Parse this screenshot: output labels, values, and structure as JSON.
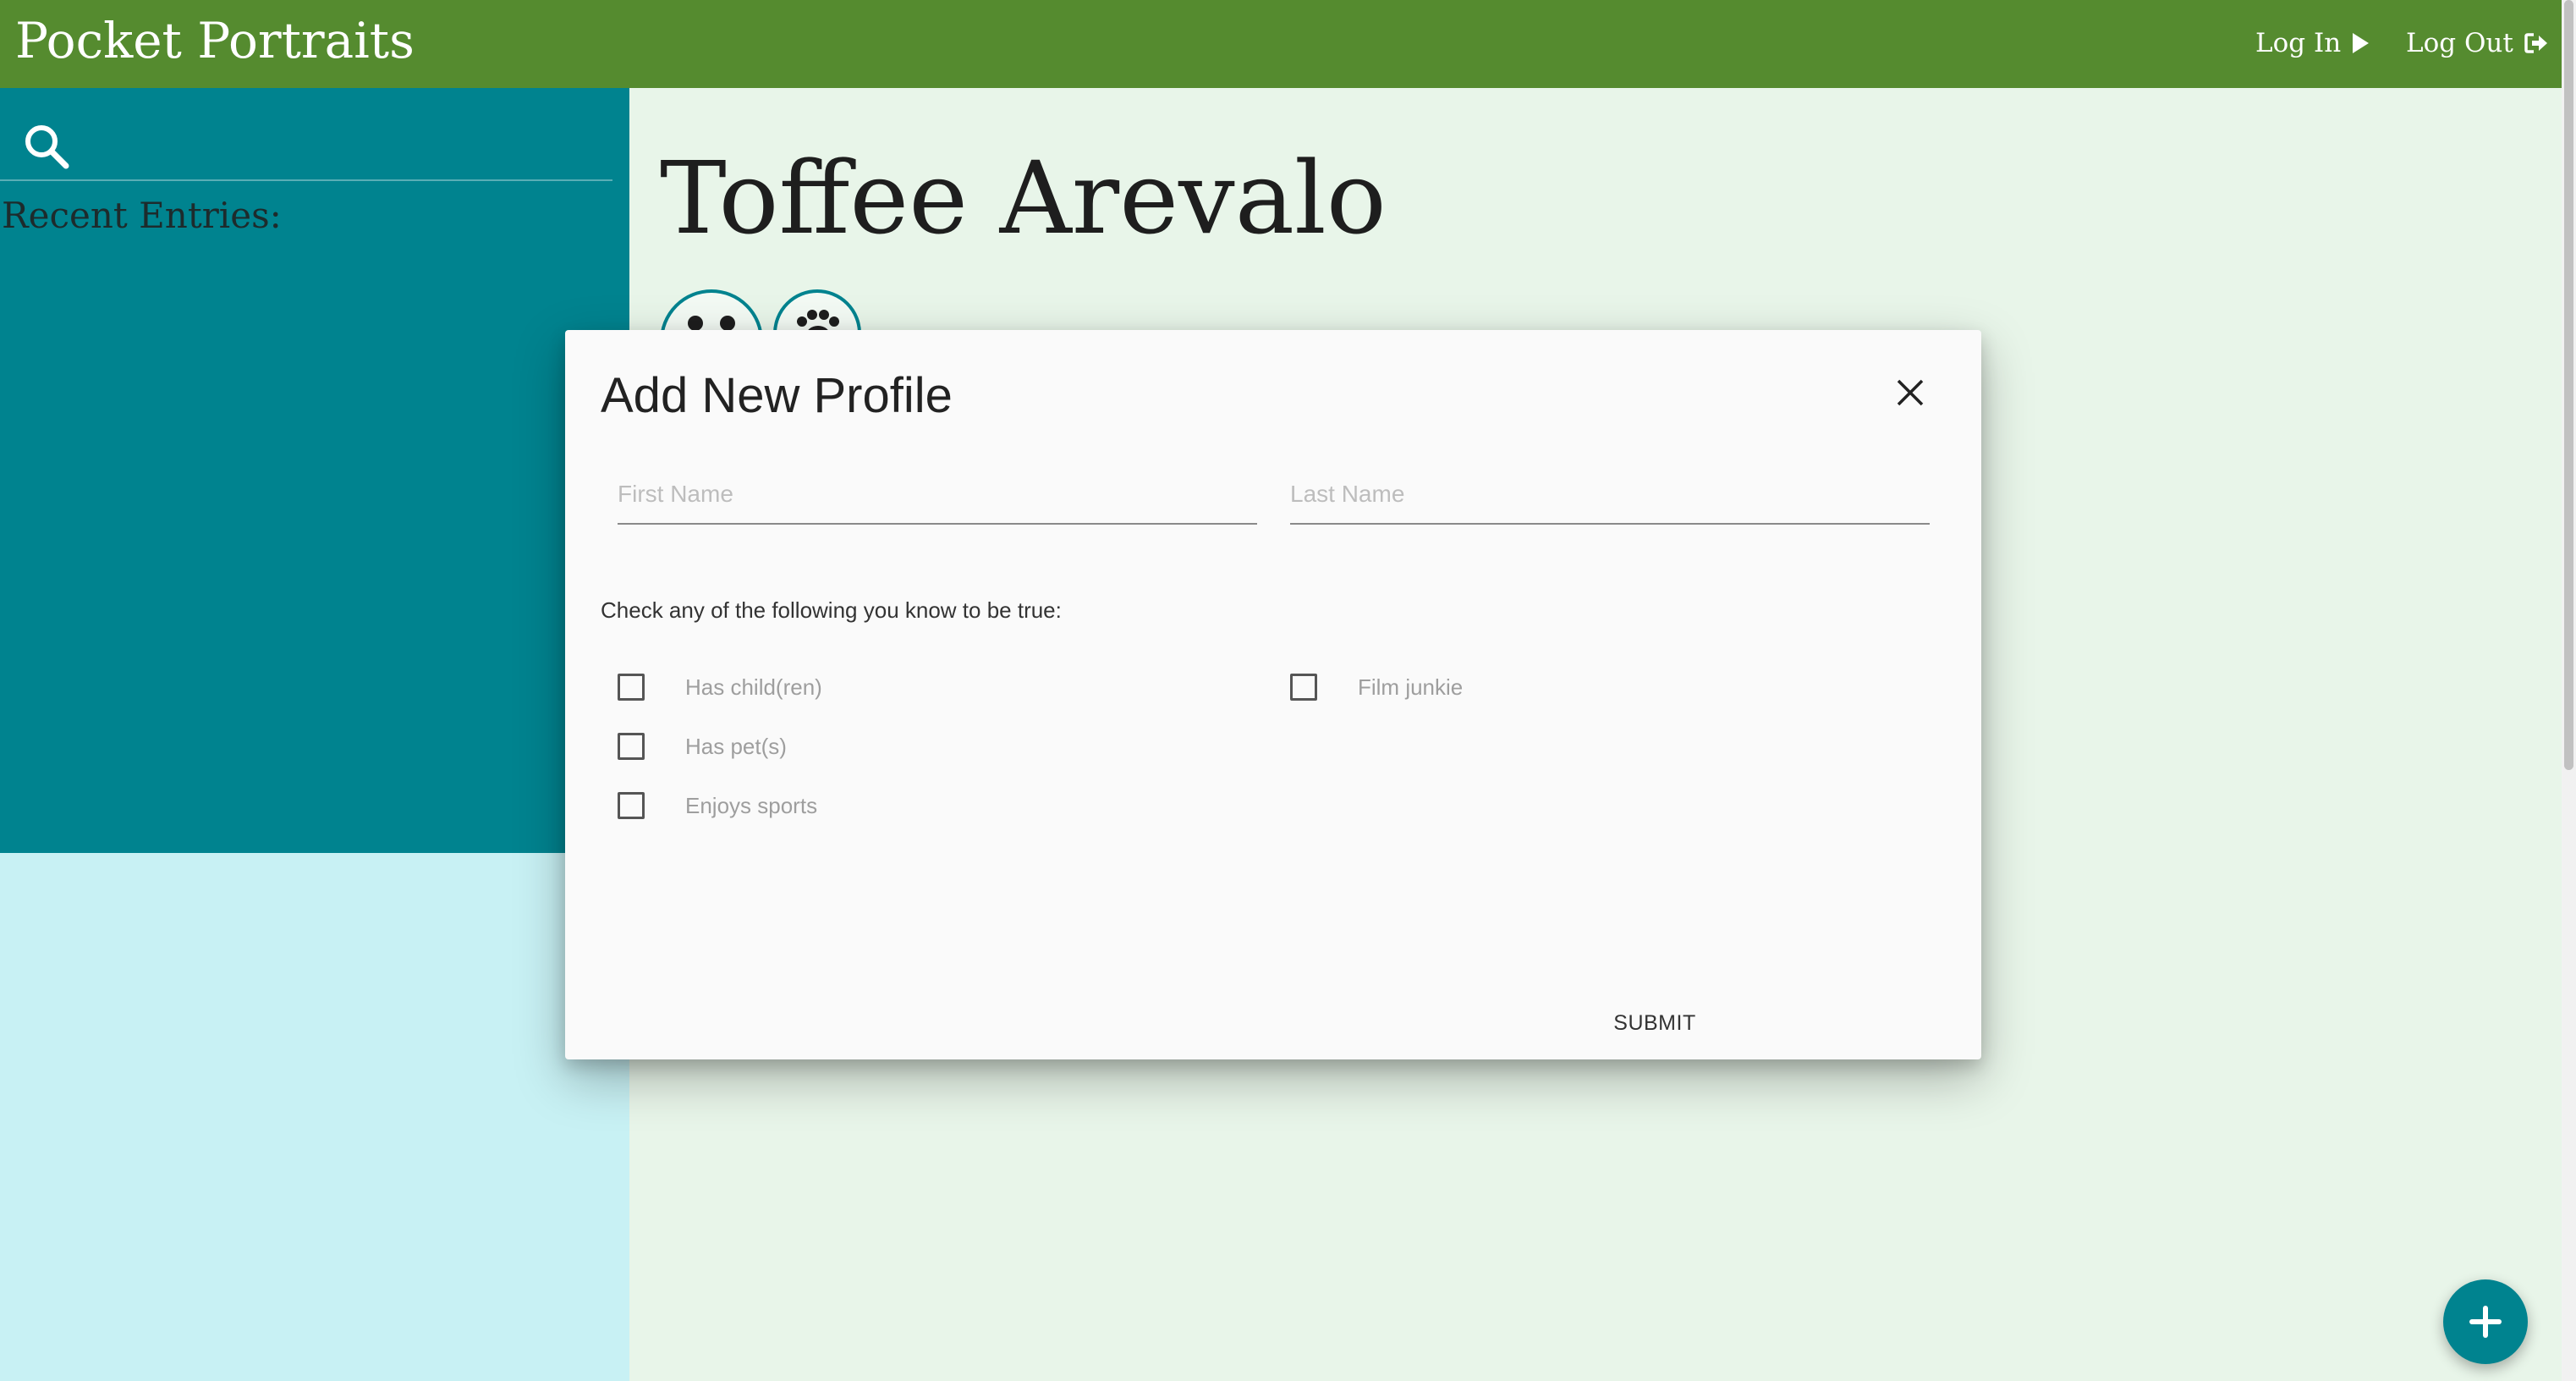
{
  "header": {
    "brand": "Pocket Portraits",
    "login_label": "Log In",
    "logout_label": "Log Out",
    "background": "#558b2f"
  },
  "sidebar": {
    "search_placeholder": "",
    "recent_title": "Recent Entries:",
    "entries": [],
    "accent_color": "#00838f",
    "lower_color": "#c8f1f4"
  },
  "main": {
    "profile_name": "Toffee Arevalo",
    "badges": [
      {
        "icon": "children-icon"
      },
      {
        "icon": "paw-icon"
      }
    ]
  },
  "modal": {
    "title": "Add New Profile",
    "first_name": {
      "value": "",
      "placeholder": "First Name"
    },
    "last_name": {
      "value": "",
      "placeholder": "Last Name"
    },
    "instructions": "Check any of the following you know to be true:",
    "options": [
      {
        "label": "Has child(ren)",
        "checked": false
      },
      {
        "label": "Has pet(s)",
        "checked": false
      },
      {
        "label": "Enjoys sports",
        "checked": false
      },
      {
        "label": "Film junkie",
        "checked": false
      }
    ],
    "submit_label": "SUBMIT"
  },
  "fab": {
    "icon": "plus-icon"
  }
}
